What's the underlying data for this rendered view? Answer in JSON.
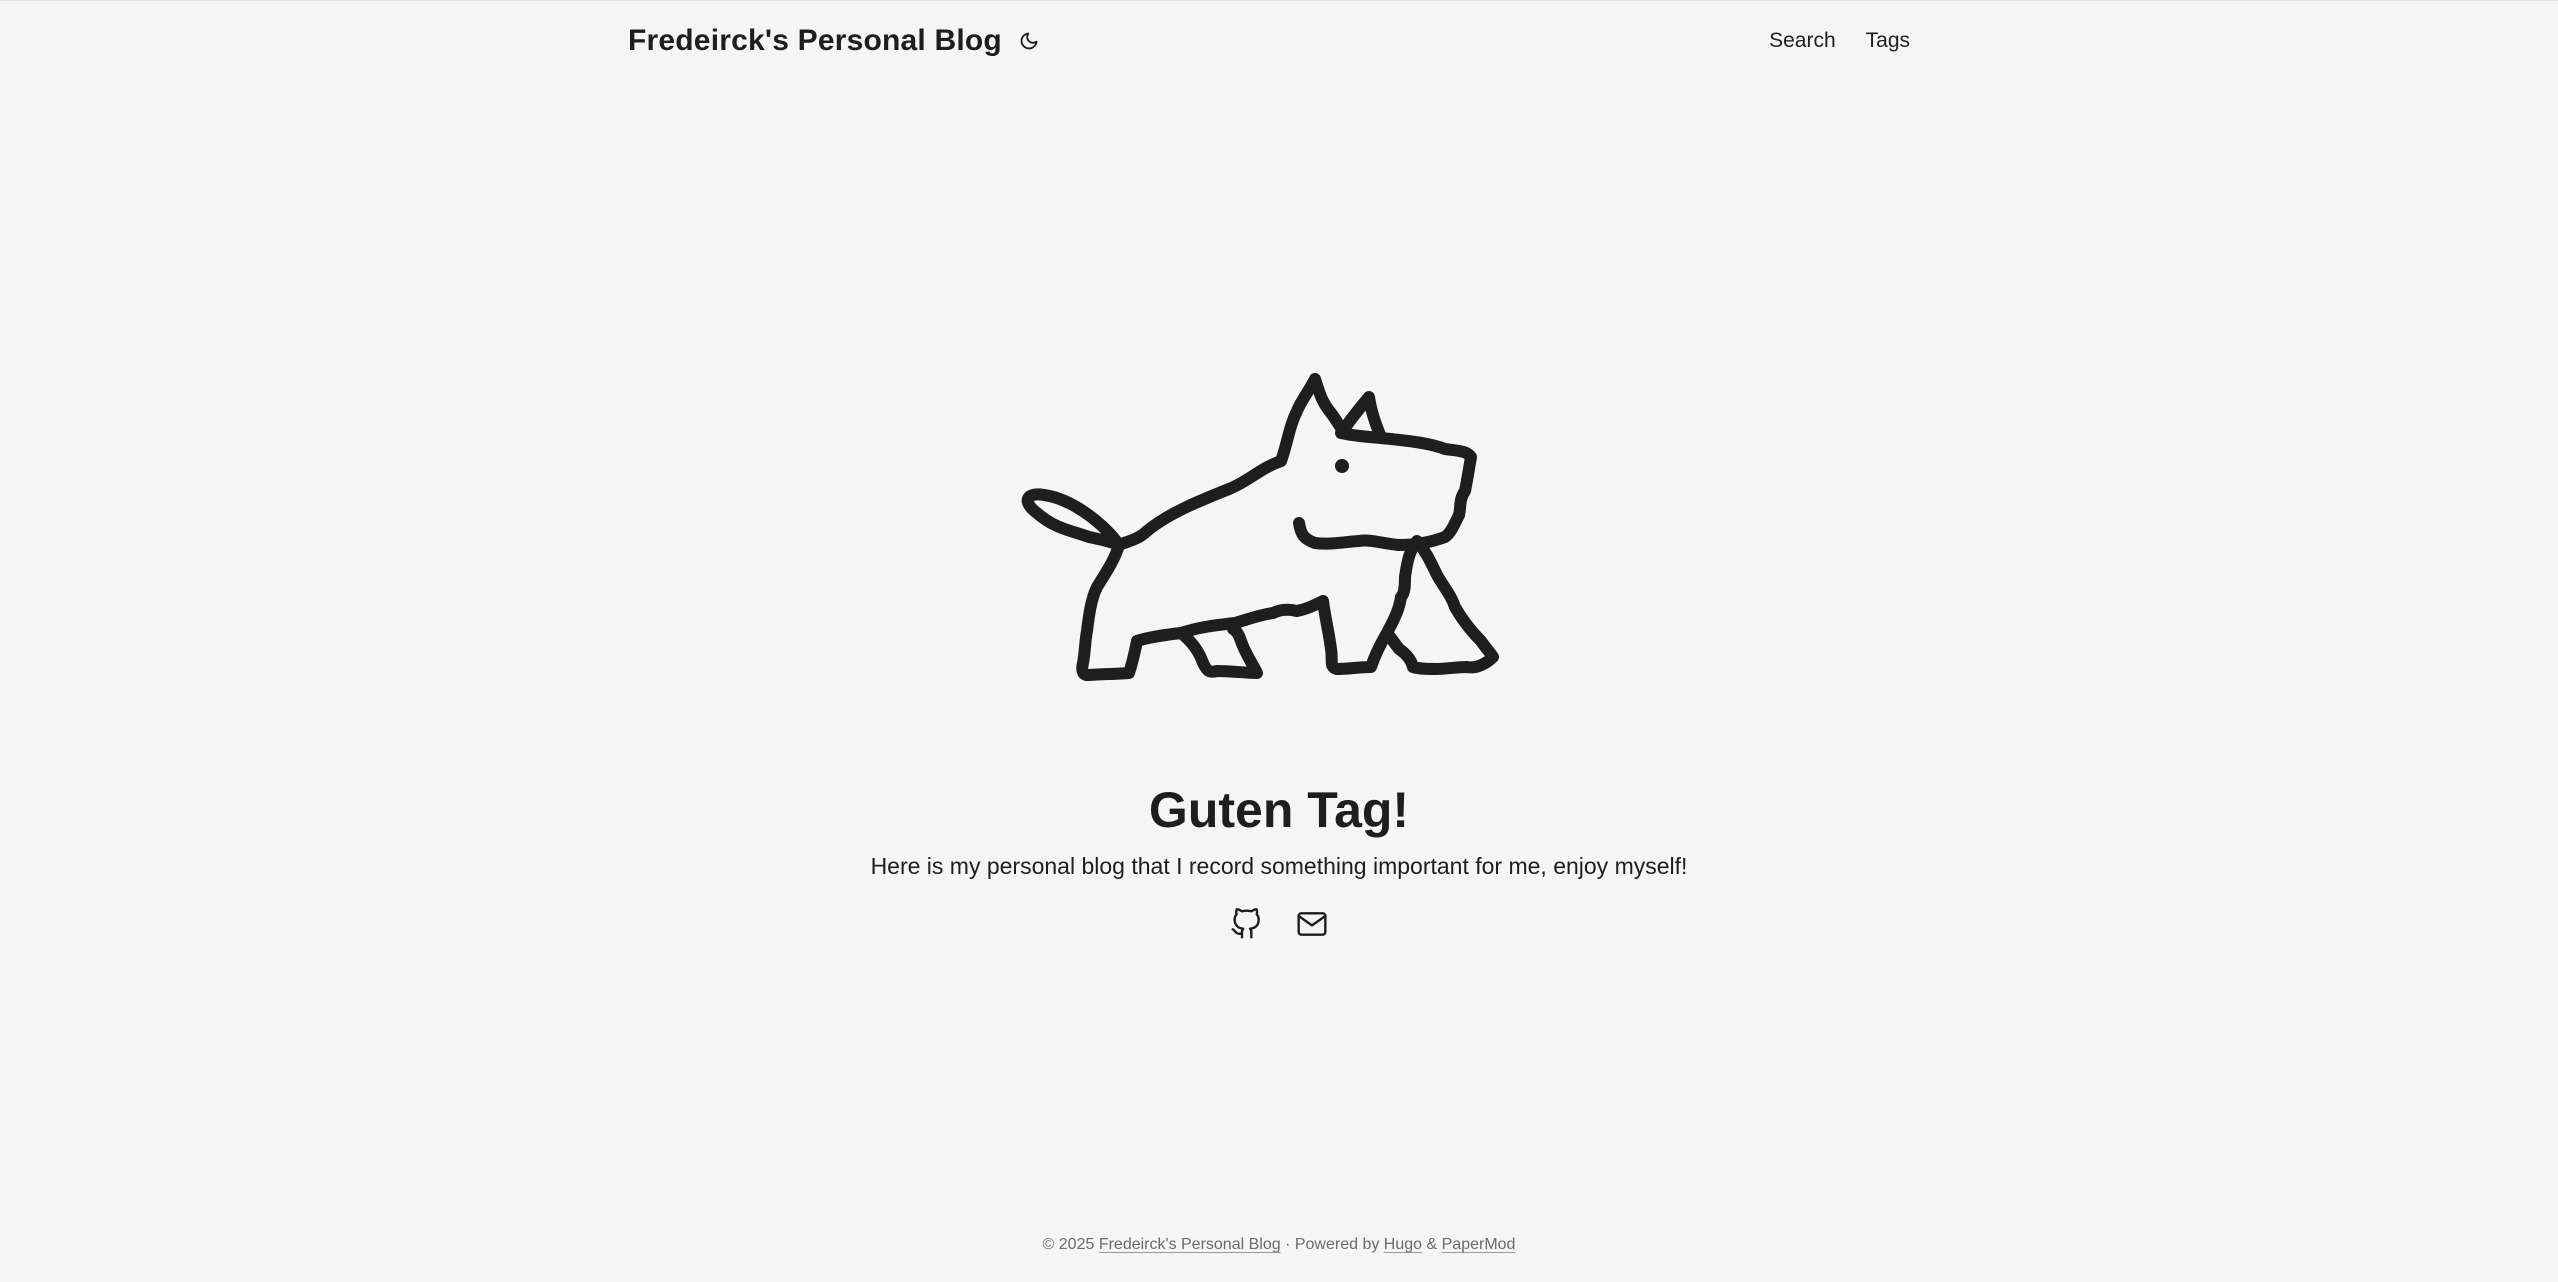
{
  "header": {
    "logo": "Fredeirck's Personal Blog",
    "theme_icon": "moon-icon",
    "menu": [
      {
        "label": "Search"
      },
      {
        "label": "Tags"
      }
    ]
  },
  "hero": {
    "illustration": "dog-drawing",
    "title": "Guten Tag!",
    "subtitle": "Here is my personal blog that I record something important for me, enjoy myself!",
    "social_icons": [
      "github-icon",
      "mail-icon"
    ]
  },
  "footer": {
    "copyright": "© 2025",
    "site_link": "Fredeirck's Personal Blog",
    "powered_by": "· Powered by",
    "hugo_link": "Hugo",
    "amp": "&",
    "papermod_link": "PaperMod"
  },
  "colors": {
    "background": "#f5f5f5",
    "text": "#1e1e1e",
    "muted": "#6b6b6b"
  }
}
